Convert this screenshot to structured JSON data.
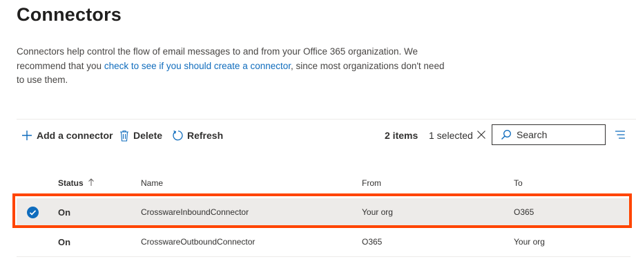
{
  "page": {
    "title": "Connectors",
    "description_before": "Connectors help control the flow of email messages to and from your Office 365 organization. We recommend that you ",
    "description_link": "check to see if you should create a connector",
    "description_after": ", since most organizations don't need to use them."
  },
  "toolbar": {
    "add_label": "Add a connector",
    "delete_label": "Delete",
    "refresh_label": "Refresh",
    "item_count": "2 items",
    "selected_text": "1 selected",
    "search_placeholder": "Search"
  },
  "table": {
    "columns": [
      "Status",
      "Name",
      "From",
      "To"
    ],
    "rows": [
      {
        "status": "On",
        "name": "CrosswareInboundConnector",
        "from": "Your org",
        "to": "O365",
        "selected": true
      },
      {
        "status": "On",
        "name": "CrosswareOutboundConnector",
        "from": "O365",
        "to": "Your org",
        "selected": false
      }
    ]
  },
  "colors": {
    "accent": "#0f6cbd",
    "selected_row_bg": "#edebe9",
    "highlight_border": "#ff4500"
  },
  "icons": [
    "add-icon",
    "delete-icon",
    "refresh-icon",
    "close-icon",
    "search-icon",
    "filter-icon",
    "sort-ascending-icon",
    "checkmark-icon"
  ]
}
